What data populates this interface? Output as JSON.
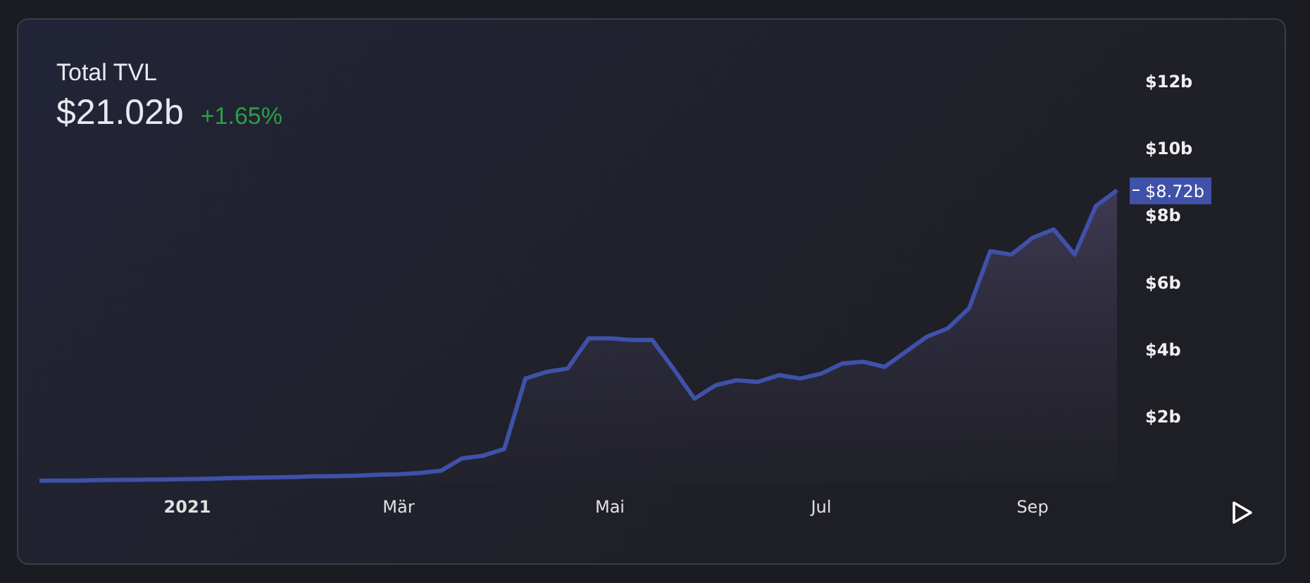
{
  "header": {
    "title": "Total TVL",
    "value": "$21.02b",
    "change": "+1.65%"
  },
  "chart": {
    "last_value_label": "$8.72b",
    "chart_data": {
      "type": "area",
      "categories": [
        null,
        null,
        null,
        null,
        null,
        null,
        null,
        "2021",
        null,
        null,
        null,
        null,
        null,
        null,
        null,
        null,
        null,
        "Mär",
        null,
        null,
        null,
        null,
        null,
        null,
        null,
        null,
        null,
        "Mai",
        null,
        null,
        null,
        null,
        null,
        null,
        null,
        null,
        null,
        "Jul",
        null,
        null,
        null,
        null,
        null,
        null,
        null,
        null,
        null,
        "Sep",
        null,
        null,
        null,
        null
      ],
      "series": [
        {
          "color": "#3f51a8",
          "values": [
            0.05,
            0.055,
            0.06,
            0.07,
            0.08,
            0.085,
            0.09,
            0.1,
            0.11,
            0.13,
            0.14,
            0.15,
            0.16,
            0.18,
            0.19,
            0.2,
            0.23,
            0.25,
            0.28,
            0.35,
            0.72,
            0.8,
            1.0,
            3.1,
            3.3,
            3.4,
            4.3,
            4.3,
            4.25,
            4.25,
            3.4,
            2.5,
            2.9,
            3.05,
            3.0,
            3.2,
            3.1,
            3.25,
            3.55,
            3.6,
            3.45,
            3.9,
            4.35,
            4.6,
            5.2,
            6.9,
            6.8,
            7.3,
            7.55,
            6.8,
            8.25,
            8.72
          ]
        }
      ],
      "ylim": [
        0,
        12
      ],
      "yticks": [
        {
          "value": 2,
          "label": "$2b"
        },
        {
          "value": 4,
          "label": "$4b"
        },
        {
          "value": 6,
          "label": "$6b"
        },
        {
          "value": 8,
          "label": "$8b"
        },
        {
          "value": 10,
          "label": "$10b"
        },
        {
          "value": 12,
          "label": "$12b"
        }
      ]
    }
  }
}
